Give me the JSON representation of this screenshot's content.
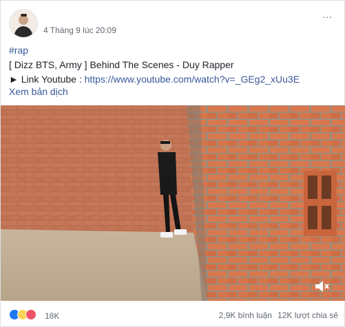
{
  "post": {
    "author_name": "",
    "timestamp": "4 Tháng 9 lúc 20:09",
    "more_menu": "...",
    "hashtag": "#rap",
    "title_line": "[ Dizz BTS, Army ] Behind The Scenes - Duy Rapper",
    "link_prefix": "► Link Youtube : ",
    "link_url": "https://www.youtube.com/watch?v=_GEg2_xUu3E",
    "translate_label": "Xem bản dịch"
  },
  "video": {
    "mute_icon": "speaker-muted-icon"
  },
  "footer": {
    "reaction_count": "18K",
    "comments": "2,9K bình luận",
    "shares": "12K lượt chia sẻ"
  },
  "colors": {
    "link": "#385898",
    "like": "#2078f4",
    "haha": "#fcd356",
    "love": "#f25268"
  }
}
